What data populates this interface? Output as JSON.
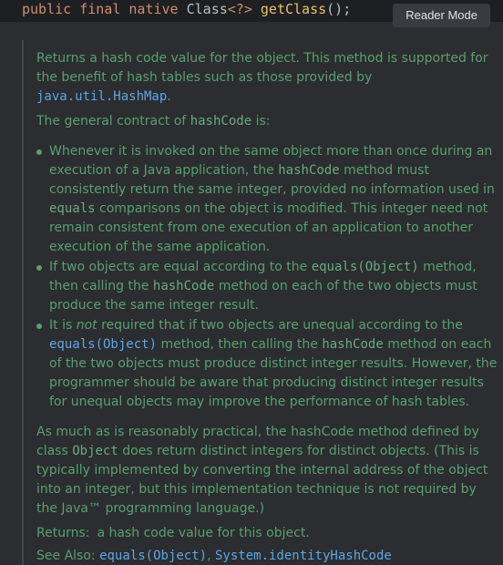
{
  "code": {
    "t1": "public",
    "t2": "final",
    "t3": "native",
    "t4": "Class",
    "t5": "<?>",
    "t6": "getClass",
    "t7": "();"
  },
  "reader_mode_label": "Reader Mode",
  "doc": {
    "p1_a": "Returns a hash code value for the object. This method is supported for the benefit of hash tables such as those provided by ",
    "p1_link": "java.util.HashMap",
    "p1_b": ".",
    "p2_a": "The general contract of ",
    "p2_code": "hashCode",
    "p2_b": " is:",
    "b1_a": "Whenever it is invoked on the same object more than once during an execution of a Java application, the ",
    "b1_code1": "hashCode",
    "b1_b": " method must consistently return the same integer, provided no information used in ",
    "b1_code2": "equals",
    "b1_c": " comparisons on the object is modified. This integer need not remain consistent from one execution of an application to another execution of the same application.",
    "b2_a": "If two objects are equal according to the ",
    "b2_code1": "equals(Object)",
    "b2_b": " method, then calling the ",
    "b2_code2": "hashCode",
    "b2_c": " method on each of the two objects must produce the same integer result.",
    "b3_a": "It is ",
    "b3_em": "not",
    "b3_b": " required that if two objects are unequal according to the ",
    "b3_link": "equals(Object)",
    "b3_c": " method, then calling the ",
    "b3_code": "hashCode",
    "b3_d": " method on each of the two objects must produce distinct integer results. However, the programmer should be aware that producing distinct integer results for unequal objects may improve the performance of hash tables.",
    "p3_a": "As much as is reasonably practical, the hashCode method defined by class ",
    "p3_code": "Object",
    "p3_b": " does return distinct integers for distinct objects. (This is typically implemented by converting the internal address of the object into an integer, but this implementation technique is not required by the Java™ programming language.)",
    "returns_label": "Returns:",
    "returns_value": "a hash code value for this object.",
    "see_also_label": "See Also:",
    "see_also_link1": "equals(Object)",
    "see_also_sep": ", ",
    "see_also_link2": "System.identityHashCode"
  }
}
